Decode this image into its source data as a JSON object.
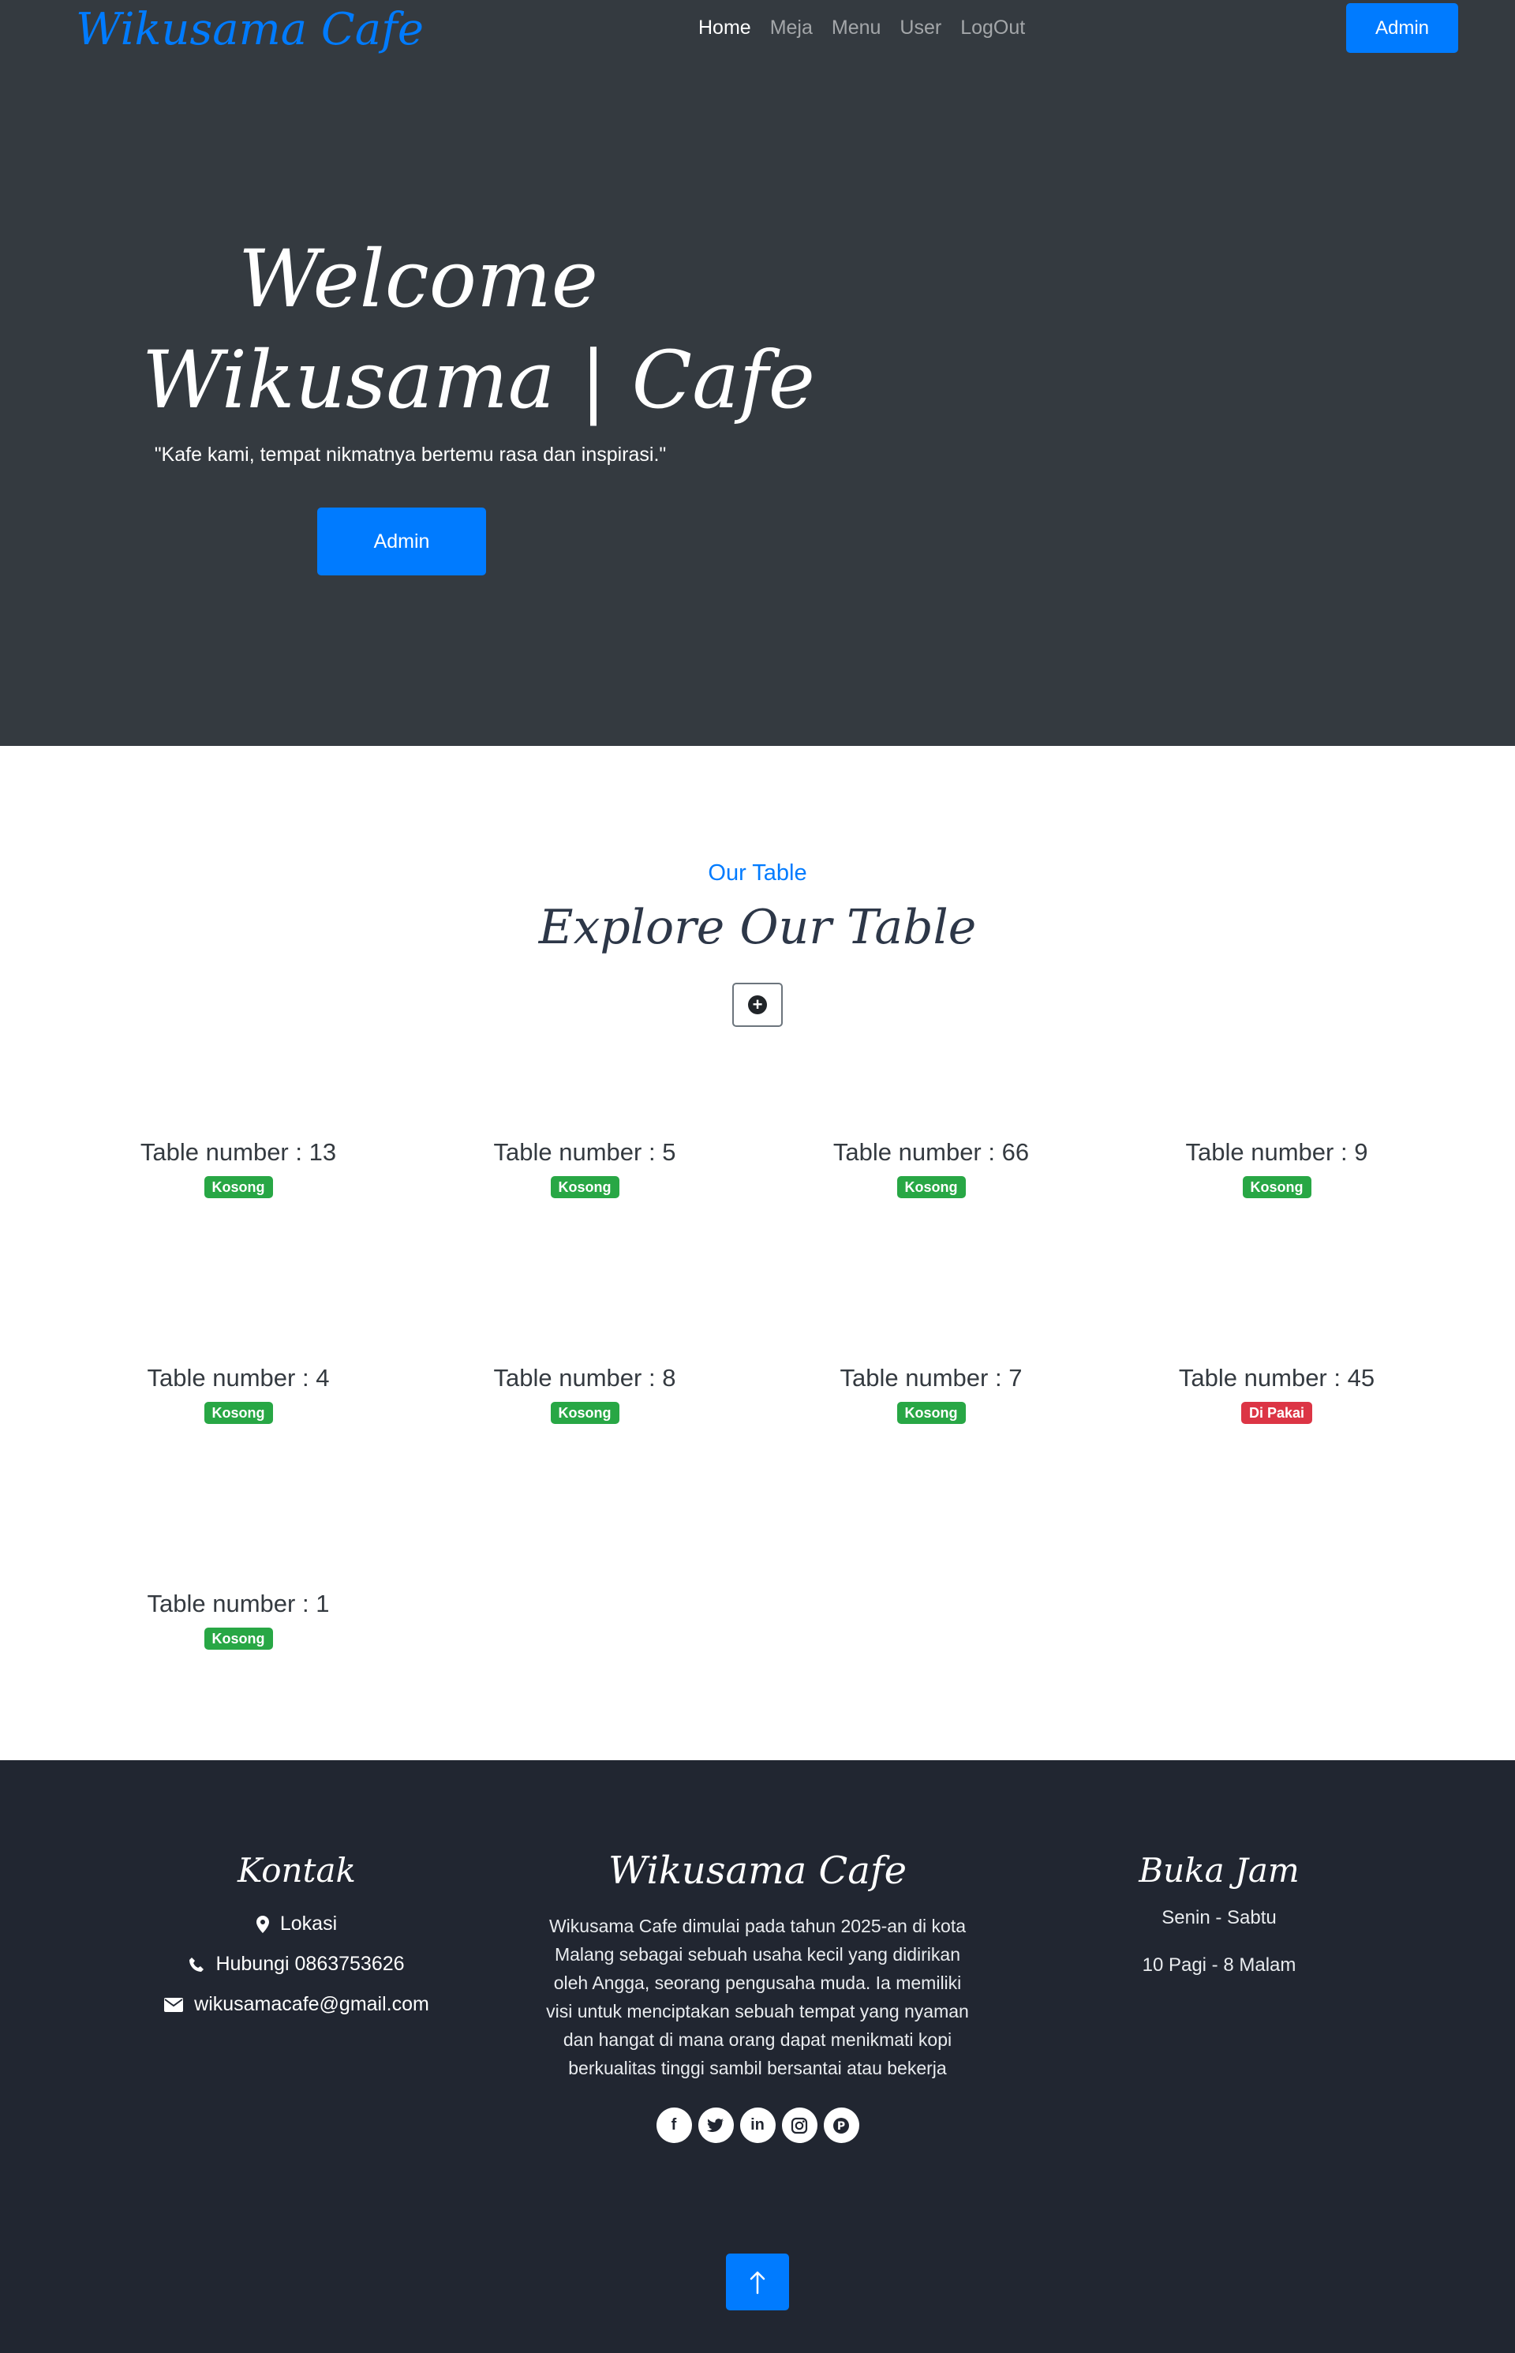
{
  "nav": {
    "brand": "Wikusama Cafe",
    "links": [
      "Home",
      "Meja",
      "Menu",
      "User",
      "LogOut"
    ],
    "admin_button": "Admin"
  },
  "hero": {
    "title_line1": "Welcome",
    "title_line2": "Wikusama | Cafe",
    "subtitle": "\"Kafe kami, tempat nikmatnya bertemu rasa dan inspirasi.\"",
    "admin_button": "Admin"
  },
  "tables_section": {
    "label": "Our Table",
    "title": "Explore Our Table",
    "add_icon": "plus-circle-icon",
    "tables": [
      {
        "name": "Table number : 13",
        "status": "Kosong"
      },
      {
        "name": "Table number : 5",
        "status": "Kosong"
      },
      {
        "name": "Table number : 66",
        "status": "Kosong"
      },
      {
        "name": "Table number : 9",
        "status": "Kosong"
      },
      {
        "name": "Table number : 4",
        "status": "Kosong"
      },
      {
        "name": "Table number : 8",
        "status": "Kosong"
      },
      {
        "name": "Table number : 7",
        "status": "Kosong"
      },
      {
        "name": "Table number : 45",
        "status": "Di Pakai"
      },
      {
        "name": "Table number : 1",
        "status": "Kosong"
      }
    ],
    "status_colors": {
      "Kosong": "#28a745",
      "Di Pakai": "#dc3545"
    }
  },
  "footer": {
    "contact": {
      "heading": "Kontak",
      "location": "Lokasi",
      "phone": "Hubungi 0863753626",
      "email": "wikusamacafe@gmail.com"
    },
    "about": {
      "heading": "Wikusama Cafe",
      "text": "Wikusama Cafe dimulai pada tahun 2025-an di kota Malang sebagai sebuah usaha kecil yang didirikan oleh Angga, seorang pengusaha muda. Ia memiliki visi untuk menciptakan sebuah tempat yang nyaman dan hangat di mana orang dapat menikmati kopi berkualitas tinggi sambil bersantai atau bekerja"
    },
    "hours": {
      "heading": "Buka Jam",
      "days": "Senin - Sabtu",
      "time": "10 Pagi - 8 Malam"
    },
    "social_icons": [
      "facebook-icon",
      "twitter-icon",
      "linkedin-icon",
      "instagram-icon",
      "pinterest-icon"
    ]
  },
  "colors": {
    "primary": "#007bff",
    "hero_bg": "#343a40",
    "footer_bg": "#212631"
  }
}
